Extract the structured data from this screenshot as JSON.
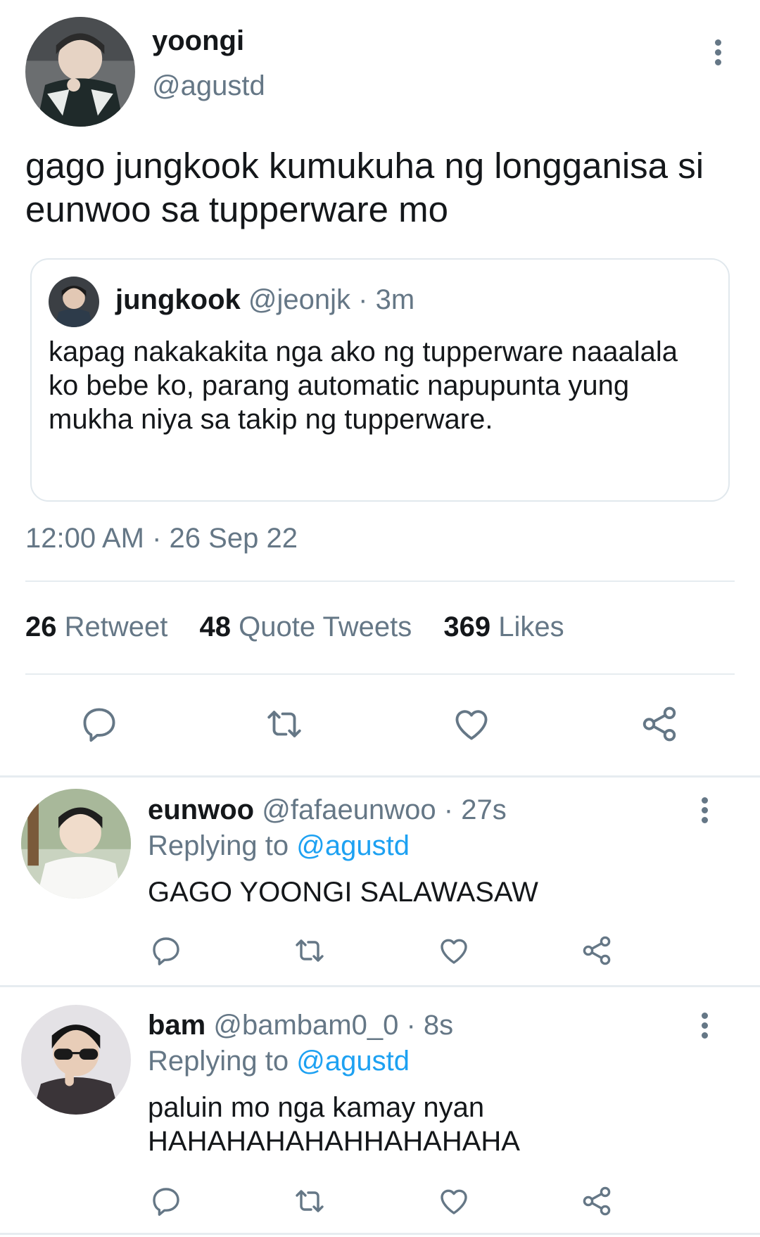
{
  "main_tweet": {
    "display_name": "yoongi",
    "handle": "@agustd",
    "text": "gago jungkook kumukuha ng longganisa si eunwoo sa tupperware mo",
    "quoted": {
      "display_name": "jungkook",
      "handle": "@jeonjk",
      "sep": "·",
      "time": "3m",
      "text": "kapag nakakakita nga ako ng tupperware naaalala ko bebe ko, parang automatic napupunta yung mukha niya sa takip ng tupperware."
    },
    "timestamp": "12:00 AM · 26 Sep 22",
    "stats": {
      "retweets": "26",
      "retweets_label": "Retweet",
      "quotes": "48",
      "quotes_label": "Quote Tweets",
      "likes": "369",
      "likes_label": "Likes"
    }
  },
  "replies": [
    {
      "display_name": "eunwoo",
      "handle": "@fafaeunwoo",
      "sep": "·",
      "time": "27s",
      "replying_label": "Replying to",
      "replying_to": "@agustd",
      "text": "GAGO YOONGI SALAWASAW"
    },
    {
      "display_name": "bam",
      "handle": "@bambam0_0",
      "sep": "·",
      "time": "8s",
      "replying_label": "Replying to",
      "replying_to": "@agustd",
      "text": "paluin mo nga kamay nyan HAHAHAHAHAHHAHAHAHA"
    }
  ],
  "icons": {
    "reply": "speech-bubble-icon",
    "retweet": "retweet-icon",
    "like": "heart-icon",
    "share": "share-icon",
    "more": "more-vertical-icon"
  },
  "colors": {
    "text": "#14171a",
    "secondary": "#657786",
    "link": "#1da1f2",
    "divider": "#e6ecf0"
  }
}
